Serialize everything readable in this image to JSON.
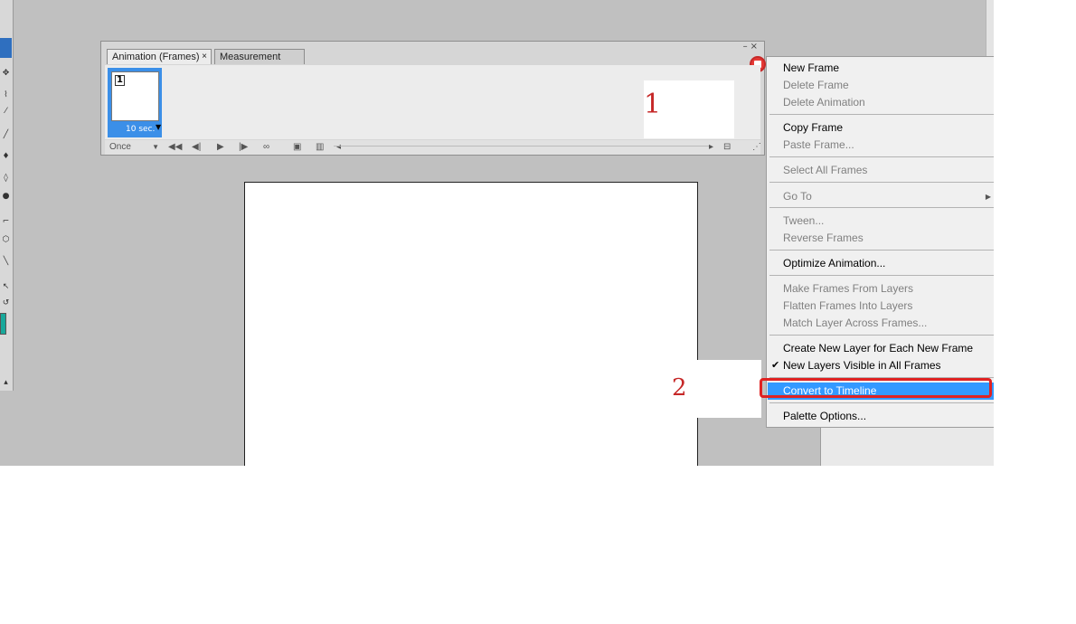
{
  "panel": {
    "tabs": [
      {
        "label": "Animation (Frames)"
      },
      {
        "label": "Measurement Log"
      }
    ],
    "tab_close_glyph": "×",
    "window_controls": "–×",
    "frames": [
      {
        "number": "1",
        "delay": "10 sec."
      }
    ],
    "loop_option": "Once",
    "controls": [
      "first-frame-icon",
      "previous-frame-icon",
      "play-icon",
      "next-frame-icon",
      "tween-icon",
      "duplicate-frame-icon",
      "delete-frame-icon"
    ],
    "convert_icon": "convert-to-timeline-icon"
  },
  "annotations": [
    {
      "label": "1"
    },
    {
      "label": "2"
    }
  ],
  "flyout_menu": {
    "items": [
      {
        "label": "New Frame",
        "enabled": true
      },
      {
        "label": "Delete Frame",
        "enabled": false
      },
      {
        "label": "Delete Animation",
        "enabled": false
      },
      {
        "label": "Copy Frame",
        "enabled": true
      },
      {
        "label": "Paste Frame...",
        "enabled": false
      },
      {
        "label": "Select All Frames",
        "enabled": false
      },
      {
        "label": "Go To",
        "enabled": false,
        "submenu": true
      },
      {
        "label": "Tween...",
        "enabled": false
      },
      {
        "label": "Reverse Frames",
        "enabled": false
      },
      {
        "label": "Optimize Animation...",
        "enabled": true
      },
      {
        "label": "Make Frames From Layers",
        "enabled": false
      },
      {
        "label": "Flatten Frames Into Layers",
        "enabled": false
      },
      {
        "label": "Match Layer Across Frames...",
        "enabled": false
      },
      {
        "label": "Create New Layer for Each New Frame",
        "enabled": true
      },
      {
        "label": "New Layers Visible in All Frames",
        "enabled": true,
        "checked": true
      },
      {
        "label": "Convert to Timeline",
        "enabled": true,
        "highlighted": true
      },
      {
        "label": "Palette Options...",
        "enabled": true
      }
    ]
  },
  "colors": {
    "workspace": "#c0c0c0",
    "highlight": "#3399ff",
    "annotation_red": "#e02222",
    "frame_selected": "#3b8fe8"
  }
}
